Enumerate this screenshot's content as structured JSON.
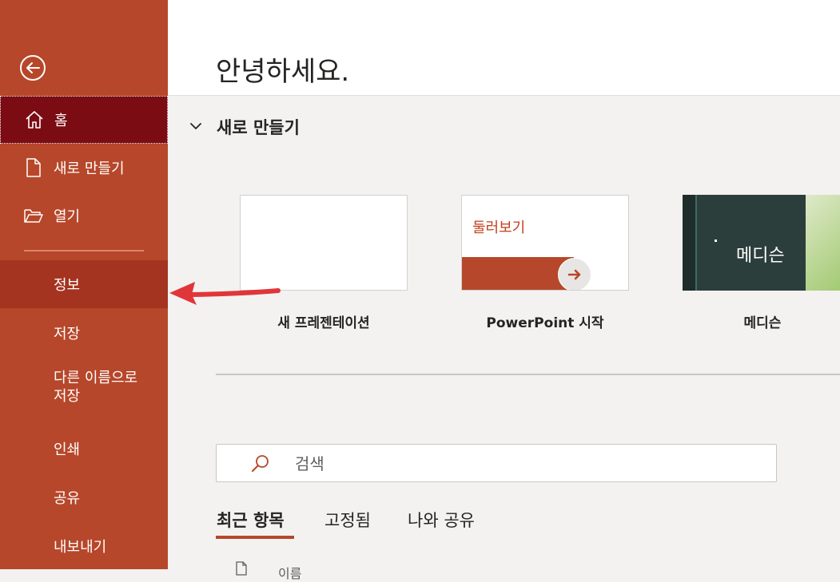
{
  "sidebar": {
    "back_icon": "back-arrow-icon",
    "items": [
      {
        "label": "홈",
        "icon": "home-icon"
      },
      {
        "label": "새로 만들기",
        "icon": "new-document-icon"
      },
      {
        "label": "열기",
        "icon": "open-folder-icon"
      },
      {
        "label": "정보"
      },
      {
        "label": "저장"
      },
      {
        "label": "다른 이름으로 저장"
      },
      {
        "label": "인쇄"
      },
      {
        "label": "공유"
      },
      {
        "label": "내보내기"
      }
    ],
    "saveas_line1": "다른 이름으로",
    "saveas_line2": "저장",
    "background": "#b7472a",
    "selected_background": "#7b0c14"
  },
  "header": {
    "greeting": "안녕하세요."
  },
  "new_section": {
    "title": "새로 만들기",
    "templates": [
      {
        "name": "새 프레젠테이션"
      },
      {
        "name": "PowerPoint 시작",
        "thumb_text": "둘러보기"
      },
      {
        "name": "메디슨",
        "thumb_text": "메디슨"
      }
    ]
  },
  "search": {
    "placeholder": "검색"
  },
  "tabs": [
    {
      "label": "최근 항목",
      "active": true
    },
    {
      "label": "고정됨"
    },
    {
      "label": "나와 공유"
    }
  ],
  "list": {
    "column_name": "이름"
  },
  "colors": {
    "accent": "#b7472a",
    "annotation_arrow": "#e0363a"
  }
}
